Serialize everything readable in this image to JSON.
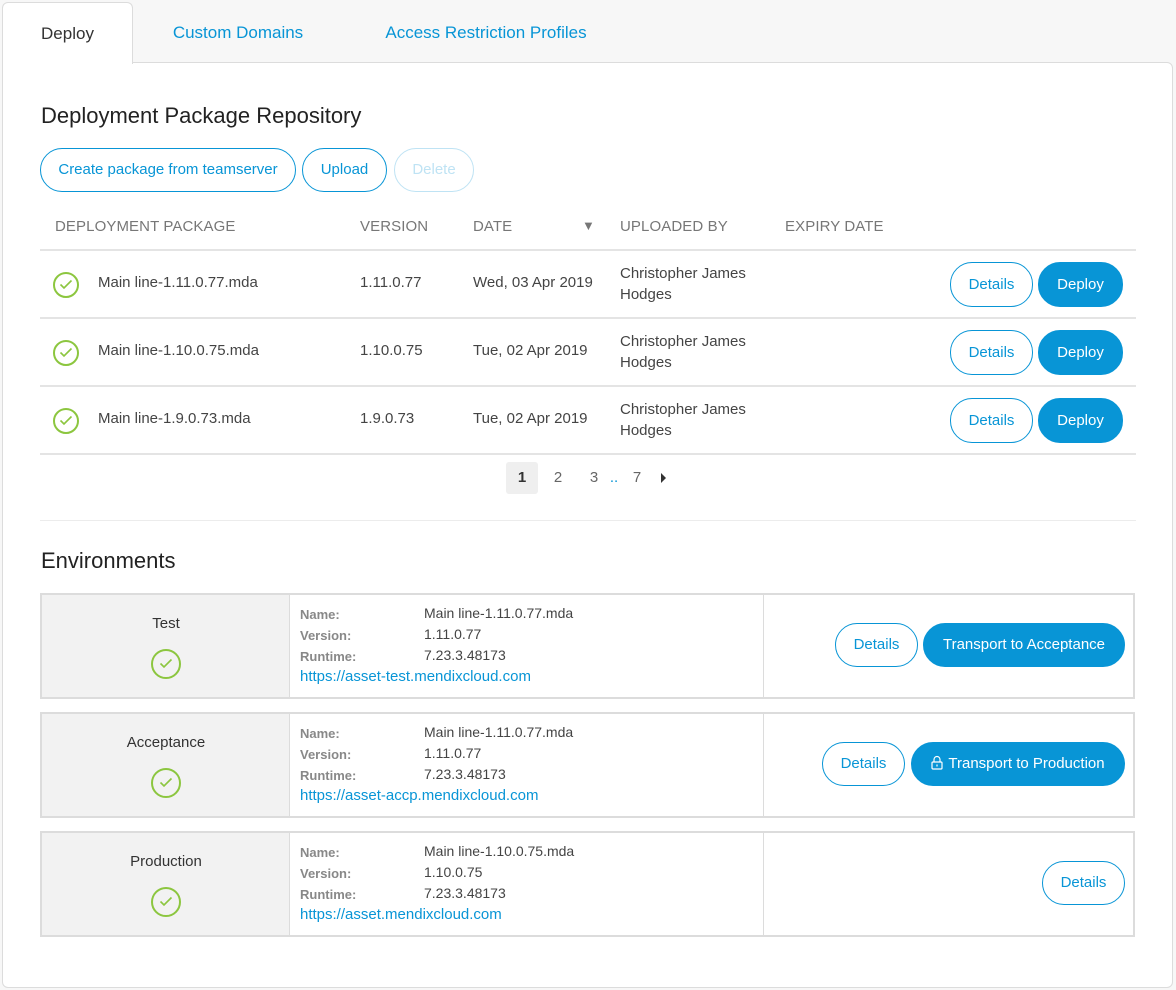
{
  "tabs": [
    {
      "label": "Deploy",
      "active": true
    },
    {
      "label": "Custom Domains",
      "active": false
    },
    {
      "label": "Access Restriction Profiles",
      "active": false
    }
  ],
  "repository": {
    "title": "Deployment Package Repository",
    "buttons": {
      "create": "Create package from teamserver",
      "upload": "Upload",
      "delete": "Delete"
    },
    "columns": [
      "DEPLOYMENT PACKAGE",
      "VERSION",
      "DATE",
      "UPLOADED BY",
      "EXPIRY DATE"
    ],
    "sort_icon": "sort-descending-icon",
    "rows": [
      {
        "status": "check-circle-icon",
        "package": "Main line-1.11.0.77.mda",
        "version": "1.11.0.77",
        "date": "Wed, 03 Apr 2019",
        "uploaded_by": "Christopher James Hodges",
        "expiry": "",
        "details_label": "Details",
        "deploy_label": "Deploy"
      },
      {
        "status": "check-circle-icon",
        "package": "Main line-1.10.0.75.mda",
        "version": "1.10.0.75",
        "date": "Tue, 02 Apr 2019",
        "uploaded_by": "Christopher James Hodges",
        "expiry": "",
        "details_label": "Details",
        "deploy_label": "Deploy"
      },
      {
        "status": "check-circle-icon",
        "package": "Main line-1.9.0.73.mda",
        "version": "1.9.0.73",
        "date": "Tue, 02 Apr 2019",
        "uploaded_by": "Christopher James Hodges",
        "expiry": "",
        "details_label": "Details",
        "deploy_label": "Deploy"
      }
    ],
    "pagination": {
      "current": "1",
      "pages": [
        "1",
        "2",
        "3"
      ],
      "ellipsis": "..",
      "last": "7",
      "next_icon": "caret-right-icon"
    }
  },
  "environments": {
    "title": "Environments",
    "labels": {
      "name": "Name:",
      "version": "Version:",
      "runtime": "Runtime:"
    },
    "items": [
      {
        "name": "Test",
        "status": "check-circle-icon",
        "package": "Main line-1.11.0.77.mda",
        "version": "1.11.0.77",
        "runtime": "7.23.3.48173",
        "url": "https://asset-test.mendixcloud.com",
        "details_label": "Details",
        "transport_label": "Transport to Acceptance",
        "transport_locked": false
      },
      {
        "name": "Acceptance",
        "status": "check-circle-icon",
        "package": "Main line-1.11.0.77.mda",
        "version": "1.11.0.77",
        "runtime": "7.23.3.48173",
        "url": "https://asset-accp.mendixcloud.com",
        "details_label": "Details",
        "transport_label": "Transport to Production",
        "transport_locked": true
      },
      {
        "name": "Production",
        "status": "check-circle-icon",
        "package": "Main line-1.10.0.75.mda",
        "version": "1.10.0.75",
        "runtime": "7.23.3.48173",
        "url": "https://asset.mendixcloud.com",
        "details_label": "Details"
      }
    ]
  },
  "colors": {
    "accent": "#0895d6",
    "success": "#8cc63f",
    "disabled": "#bfe3f4",
    "panel_background": "#f2f2f2",
    "page_background": "#f7f7f7"
  }
}
